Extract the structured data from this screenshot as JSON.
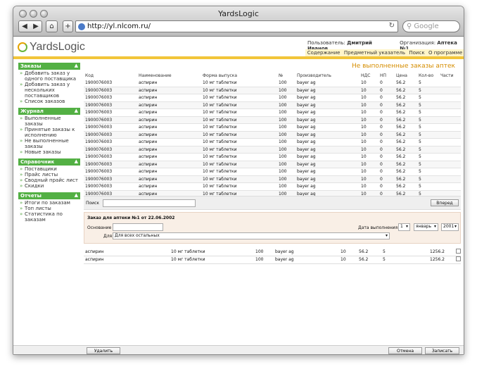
{
  "browser": {
    "title": "YardsLogic",
    "url": "http://yl.nlcom.ru/",
    "search_placeholder": "Google",
    "back": "◀",
    "forward": "▶",
    "home": "⌂",
    "add": "+",
    "reload": "↻",
    "search_icon": "⚲"
  },
  "logo": {
    "brand": "YardsLogic"
  },
  "user": {
    "label": "Пользователь:",
    "name": "Дмитрий Иванов",
    "org_label": "Организация:",
    "org": "Аптека №1"
  },
  "topnav": [
    "Содержание",
    "Предметный указатель",
    "Поиск",
    "О программе"
  ],
  "sidebar": [
    {
      "title": "Заказы",
      "items": [
        "Добавить заказ у одного поставщика",
        "Добавить заказ у нескольких поставщиков",
        "Список заказов"
      ]
    },
    {
      "title": "Журнал",
      "items": [
        "Выполненные заказы",
        "Принятые заказы к исполнению",
        "Не выполненные заказы",
        "Новые заказы"
      ]
    },
    {
      "title": "Справочник",
      "items": [
        "Поставщики",
        "Прайс листы",
        "Сводный прайс лист",
        "Скидки"
      ]
    },
    {
      "title": "Отчеты",
      "items": [
        "Итоги по заказам",
        "Топ листы",
        "Статистика по заказам"
      ]
    }
  ],
  "main": {
    "heading": "Не выполненные заказы аптек",
    "columns": [
      "Код",
      "Наименование",
      "Форма выпуска",
      "№",
      "Производитель",
      "НДС",
      "НП",
      "Цена",
      "Кол-во",
      "Части"
    ],
    "rows": [
      [
        "1900076003",
        "аспирин",
        "10 мг таблетки",
        "100",
        "bayer ag",
        "10",
        "0",
        "56.2",
        "5",
        ""
      ],
      [
        "1900076003",
        "аспирин",
        "10 мг таблетки",
        "100",
        "bayer ag",
        "10",
        "0",
        "56.2",
        "5",
        ""
      ],
      [
        "1900076003",
        "аспирин",
        "10 мг таблетки",
        "100",
        "bayer ag",
        "10",
        "0",
        "56.2",
        "5",
        ""
      ],
      [
        "1900076003",
        "аспирин",
        "10 мг таблетки",
        "100",
        "bayer ag",
        "10",
        "0",
        "56.2",
        "5",
        ""
      ],
      [
        "1900076003",
        "аспирин",
        "10 мг таблетки",
        "100",
        "bayer ag",
        "10",
        "0",
        "56.2",
        "5",
        ""
      ],
      [
        "1900076003",
        "аспирин",
        "10 мг таблетки",
        "100",
        "bayer ag",
        "10",
        "0",
        "56.2",
        "5",
        ""
      ],
      [
        "1900076003",
        "аспирин",
        "10 мг таблетки",
        "100",
        "bayer ag",
        "10",
        "0",
        "56.2",
        "5",
        ""
      ],
      [
        "1900076003",
        "аспирин",
        "10 мг таблетки",
        "100",
        "bayer ag",
        "10",
        "0",
        "56.2",
        "5",
        ""
      ],
      [
        "1900076003",
        "аспирин",
        "10 мг таблетки",
        "100",
        "bayer ag",
        "10",
        "0",
        "56.2",
        "5",
        ""
      ],
      [
        "1900076003",
        "аспирин",
        "10 мг таблетки",
        "100",
        "bayer ag",
        "10",
        "0",
        "56.2",
        "5",
        ""
      ],
      [
        "1900076003",
        "аспирин",
        "10 мг таблетки",
        "100",
        "bayer ag",
        "10",
        "0",
        "56.2",
        "5",
        ""
      ],
      [
        "1900076003",
        "аспирин",
        "10 мг таблетки",
        "100",
        "bayer ag",
        "10",
        "0",
        "56.2",
        "5",
        ""
      ],
      [
        "1900076003",
        "аспирин",
        "10 мг таблетки",
        "100",
        "bayer ag",
        "10",
        "0",
        "56.2",
        "5",
        ""
      ],
      [
        "1900076003",
        "аспирин",
        "10 мг таблетки",
        "100",
        "bayer ag",
        "10",
        "0",
        "56.2",
        "5",
        ""
      ],
      [
        "1900076003",
        "аспирин",
        "10 мг таблетки",
        "100",
        "bayer ag",
        "10",
        "0",
        "56.2",
        "5",
        ""
      ],
      [
        "1900076003",
        "аспирин",
        "10 мг таблетки",
        "100",
        "bayer ag",
        "10",
        "0",
        "56.2",
        "5",
        ""
      ]
    ],
    "search_label": "Поиск",
    "forward_btn": "Вперед"
  },
  "order": {
    "title": "Заказ для аптеки №1 от 22.06.2002",
    "base_label": "Основание",
    "for_label": "Для",
    "for_value": "Для всех остальных",
    "date_label": "Дата выполнения",
    "day": "1",
    "month": "январь",
    "year": "2001",
    "items": [
      [
        "аспирин",
        "10 мг таблетки",
        "100",
        "bayer ag",
        "10",
        "56.2",
        "5",
        "1256.2"
      ],
      [
        "аспирин",
        "10 мг таблетки",
        "100",
        "bayer ag",
        "10",
        "56.2",
        "5",
        "1256.2"
      ]
    ]
  },
  "buttons": {
    "delete": "Удалить",
    "cancel": "Отмена",
    "save": "Записать"
  }
}
